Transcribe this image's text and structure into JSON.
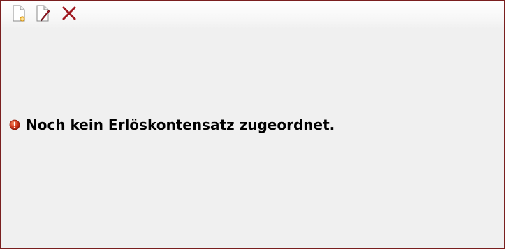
{
  "toolbar": {
    "buttons": [
      {
        "icon": "new-document-icon"
      },
      {
        "icon": "edit-document-icon"
      },
      {
        "icon": "delete-icon"
      }
    ]
  },
  "message": {
    "icon": "warning-icon",
    "text": "Noch kein Erlöskontensatz zugeordnet."
  },
  "colors": {
    "frame_border": "#7a1f1f",
    "background": "#f0f0f0",
    "delete_red": "#a01820",
    "warning_red": "#d03a22"
  }
}
